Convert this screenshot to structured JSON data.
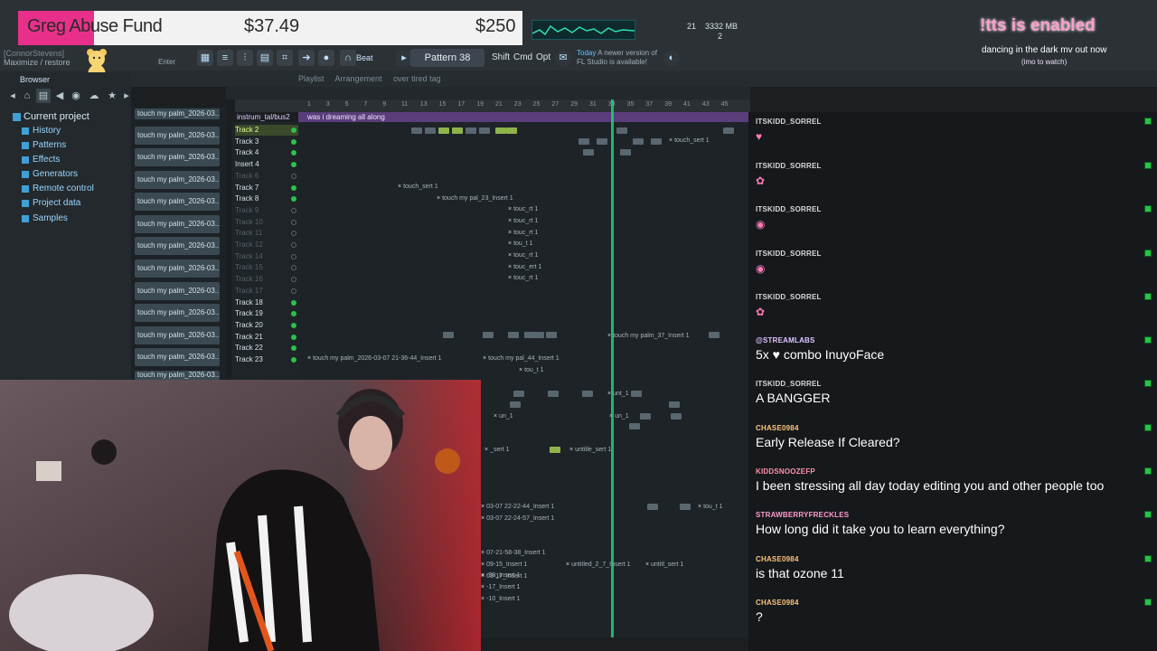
{
  "donation": {
    "name": "Greg Abuse Fund",
    "raised": "$37.49",
    "goal": "$250"
  },
  "toolbar": {
    "user": "[ConnorStevens]",
    "window_hint": "Maximize / restore",
    "enter_label": "Enter",
    "beat_label": "Beat",
    "pattern": "Pattern 38",
    "shift": "Shift",
    "cmd": "Cmd",
    "opt": "Opt",
    "news_today": "Today",
    "news_text": "A newer version of",
    "news_text2": "FL Studio is available!",
    "cpu_value": "21",
    "mem_mb": "3332 MB",
    "voices": "2"
  },
  "browser": {
    "label": "Browser",
    "tree": [
      {
        "label": "Current project"
      },
      {
        "label": "History"
      },
      {
        "label": "Patterns"
      },
      {
        "label": "Effects"
      },
      {
        "label": "Generators"
      },
      {
        "label": "Remote control"
      },
      {
        "label": "Project data"
      },
      {
        "label": "Samples"
      }
    ]
  },
  "picker": {
    "items": [
      "touch my palm_2026-03...",
      "touch my palm_2026-03...",
      "touch my palm_2026-03...",
      "touch my palm_2026-03...",
      "touch my palm_2026-03...",
      "touch my palm_2026-03...",
      "touch my palm_2026-03...",
      "touch my palm_2026-03...",
      "touch my palm_2026-03...",
      "touch my palm_2026-03...",
      "touch my palm_2026-03...",
      "touch my palm_2026-03...",
      "touch my palm_2026-03..."
    ]
  },
  "playlist": {
    "title": "Playlist",
    "mode": "Arrangement",
    "name": "over tired tag",
    "insert_bar": "instrum_tal/bus2",
    "dream_clip": "was i dreaming all along",
    "ruler": [
      "1",
      "3",
      "5",
      "7",
      "9",
      "11",
      "13",
      "15",
      "17",
      "19",
      "21",
      "23",
      "25",
      "27",
      "29",
      "31",
      "33",
      "35",
      "37",
      "39",
      "41",
      "43",
      "45"
    ],
    "tracks": [
      {
        "label": "Track 2",
        "muted": false
      },
      {
        "label": "Track 3",
        "muted": false
      },
      {
        "label": "Track 4",
        "muted": false
      },
      {
        "label": "Insert 4",
        "muted": false
      },
      {
        "label": "Track 6",
        "muted": true
      },
      {
        "label": "Track 7",
        "muted": false
      },
      {
        "label": "Track 8",
        "muted": false
      },
      {
        "label": "Track 9",
        "muted": true
      },
      {
        "label": "Track 10",
        "muted": true
      },
      {
        "label": "Track 11",
        "muted": true
      },
      {
        "label": "Track 12",
        "muted": true
      },
      {
        "label": "Track 14",
        "muted": true
      },
      {
        "label": "Track 15",
        "muted": true
      },
      {
        "label": "Track 16",
        "muted": true
      },
      {
        "label": "Track 17",
        "muted": true
      },
      {
        "label": "Track 18",
        "muted": false
      },
      {
        "label": "Track 19",
        "muted": false
      },
      {
        "label": "Track 20",
        "muted": false
      },
      {
        "label": "Track 21",
        "muted": false
      },
      {
        "label": "Track 22",
        "muted": false
      },
      {
        "label": "Track 23",
        "muted": false
      }
    ],
    "clips": [
      "touch_sert 1",
      "touch_sert 1",
      "touch my pal_23_Insert 1",
      "touc_rt 1",
      "touc_rt 1",
      "touc_rt 1",
      "tou_t 1",
      "touc_rt 1",
      "touc_ert 1",
      "touc_rt 1",
      "touch my palm_37_Insert 1",
      "touch my palm_2026-03-07 21-36-44_Insert 1",
      "touch my pal_44_Insert 1",
      "tou_t 1",
      "unt_1",
      "un_1",
      "un_1",
      "_sert 1",
      "untitle_sert 1",
      "03-07 22-22-44_Insert 1",
      "03-07 22-24-57_Insert 1",
      "tou_t 1",
      "07-21-58-38_Insert 1",
      "09-15_Insert 1",
      "03-17_Insert 1",
      "untitled_2_7_Insert 1",
      "untitl_sert 1",
      "-38_Insert 1",
      "-17_Insert 1",
      "-10_Insert 1"
    ]
  },
  "overlay": {
    "tts_title": "!tts is enabled",
    "now_playing": "dancing in the dark mv out now",
    "now_playing_sub": "(imo to watch)"
  },
  "chat": {
    "messages": [
      {
        "user": "ITSKIDD_SORREL",
        "text": "",
        "emote": "♥"
      },
      {
        "user": "ITSKIDD_SORREL",
        "text": "",
        "emote": "✿"
      },
      {
        "user": "ITSKIDD_SORREL",
        "text": "",
        "emote": "◉"
      },
      {
        "user": "ITSKIDD_SORREL",
        "text": "",
        "emote": "◉"
      },
      {
        "user": "ITSKIDD_SORREL",
        "text": "",
        "emote": "✿"
      },
      {
        "user": "@STREAMLABS",
        "text": "5x ♥ combo InuyoFace",
        "emote": ""
      },
      {
        "user": "ITSKIDD_SORREL",
        "text": "A BANGGER",
        "emote": ""
      },
      {
        "user": "CHASE0984",
        "text": "Early Release If Cleared?",
        "emote": ""
      },
      {
        "user": "KIDDSNOOZEFP",
        "text": "I been stressing all day today editing you and other people too",
        "emote": ""
      },
      {
        "user": "STRAWBERRYFRECKLES",
        "text": "How long did it take you to learn everything?",
        "emote": ""
      },
      {
        "user": "CHASE0984",
        "text": "is that ozone 11",
        "emote": ""
      },
      {
        "user": "CHASE0984",
        "text": "?",
        "emote": ""
      }
    ]
  },
  "colors": {
    "accent_green": "#1fd07e",
    "donation_pink": "#e8308a",
    "chat_badge": "#28c24a",
    "tts_pink": "#ff9ccc"
  }
}
